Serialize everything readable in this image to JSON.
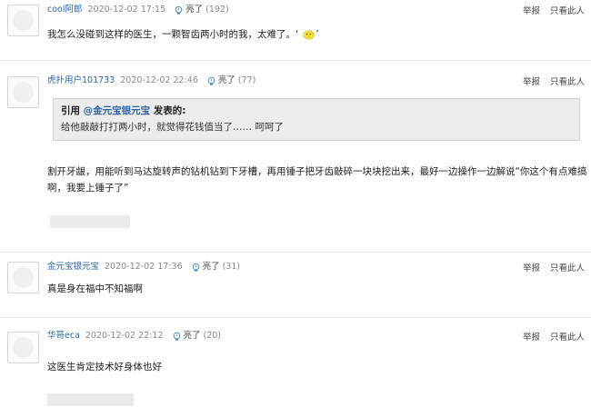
{
  "actions": {
    "report": "举报",
    "only_this": "只看此人"
  },
  "replies": [
    {
      "user": "cool阿郎",
      "time": "2020-12-02 17:15",
      "light_label": "亮了",
      "light_count": "(192)",
      "text": "我怎么没碰到这样的医生，一颗智齿两小时的我，太难了。‘",
      "text_tail": "’"
    },
    {
      "user": "虎扑用户101733",
      "time": "2020-12-02 22:46",
      "light_label": "亮了",
      "light_count": "(77)",
      "quote_prefix": "引用 ",
      "quote_user": "@金元宝银元宝",
      "quote_suffix": " 发表的:",
      "quote_text": "给他敲敲打打两小时，就觉得花钱值当了……  呵呵了",
      "text_line1": "割开牙龈，用能听到马达旋转声的钻机钻到下牙槽，再用锤子把牙齿敲碎一块块挖出来，最好一边操作一边解说“你这个有点难搞",
      "text_line2": "啊，我要上锤子了”"
    },
    {
      "user": "金元宝银元宝",
      "time": "2020-12-02 17:36",
      "light_label": "亮了",
      "light_count": "(31)",
      "text": "真是身在福中不知福啊"
    },
    {
      "user": "华哥eca",
      "time": "2020-12-02 22:12",
      "light_label": "亮了",
      "light_count": "(20)",
      "text": "这医生肯定技术好身体也好"
    }
  ]
}
